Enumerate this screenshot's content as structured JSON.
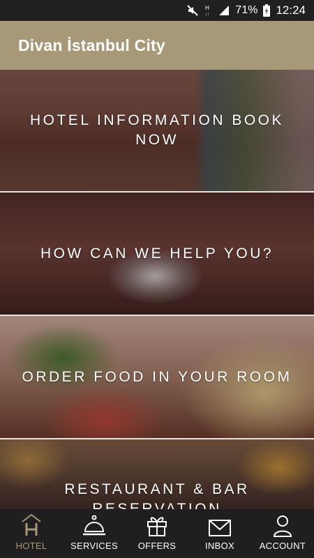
{
  "status": {
    "battery": "71%",
    "time": "12:24"
  },
  "app": {
    "title": "Divan İstanbul City"
  },
  "cards": [
    {
      "label": "HOTEL INFORMATION   BOOK NOW"
    },
    {
      "label": "HOW CAN WE HELP YOU?"
    },
    {
      "label": "ORDER FOOD IN YOUR ROOM"
    },
    {
      "label": "RESTAURANT & BAR RESERVATION"
    }
  ],
  "nav": {
    "items": [
      {
        "label": "HOTEL",
        "icon": "hotel-icon"
      },
      {
        "label": "SERVICES",
        "icon": "bell-icon"
      },
      {
        "label": "OFFERS",
        "icon": "gift-icon"
      },
      {
        "label": "INBOX",
        "icon": "envelope-icon"
      },
      {
        "label": "ACCOUNT",
        "icon": "person-icon"
      }
    ]
  },
  "colors": {
    "accent": "#a79877",
    "nav_bg": "#1f1f1f",
    "status_bg": "#202020"
  }
}
